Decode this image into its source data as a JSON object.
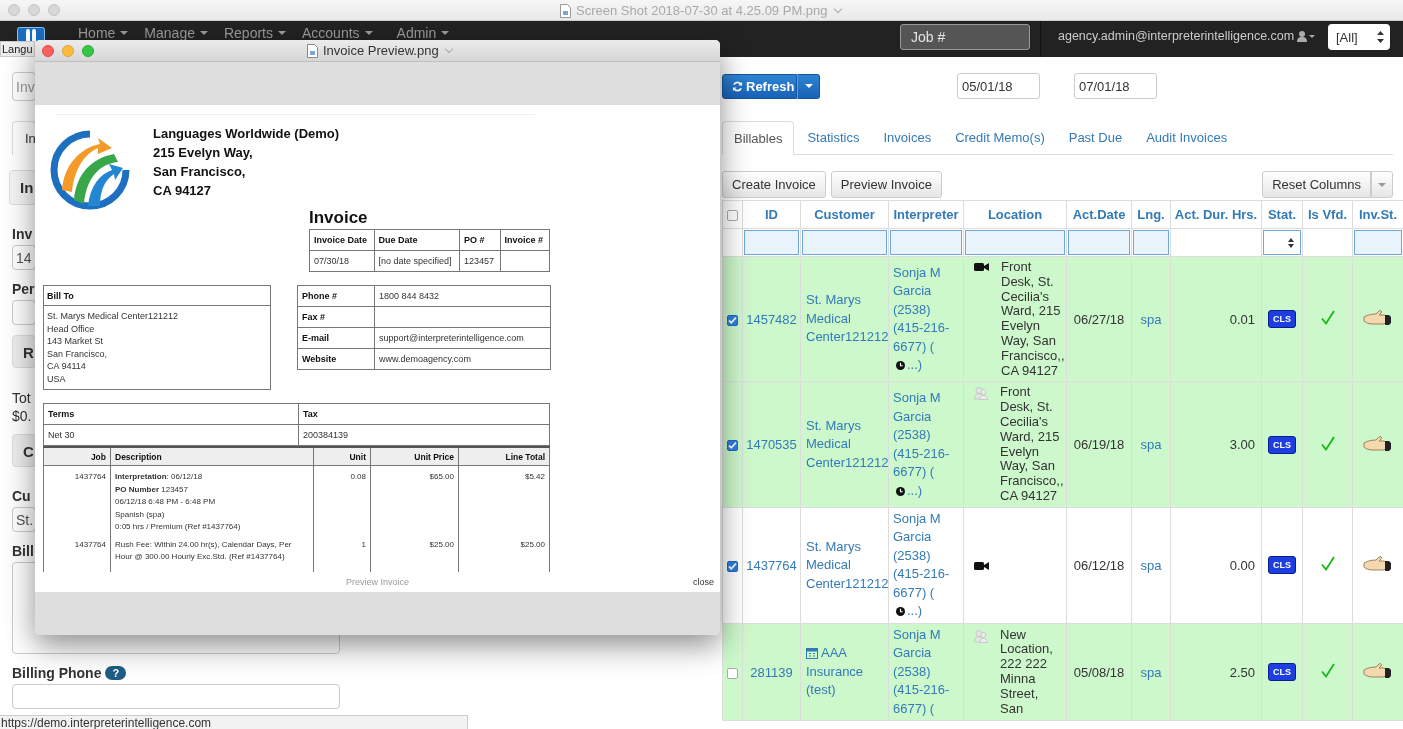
{
  "window": {
    "title": "Screen Shot 2018-07-30 at 4.25.09 PM.png"
  },
  "navbar": {
    "menu": [
      {
        "label": "Home"
      },
      {
        "label": "Manage"
      },
      {
        "label": "Reports"
      },
      {
        "label": "Accounts"
      },
      {
        "label": "Admin"
      }
    ],
    "job_search": {
      "placeholder": "Job #"
    },
    "user": "agency.admin@interpreterintelligence.com",
    "scope_select": {
      "value": "[All]"
    }
  },
  "logo_tooltip": "Langu",
  "left_panel": [
    {
      "kind": "field",
      "placeholder": "Inv"
    },
    {
      "kind": "tab",
      "text": "In"
    },
    {
      "kind": "panel",
      "text": "In"
    },
    {
      "kind": "label",
      "text": "Inv"
    },
    {
      "kind": "field",
      "value": "14"
    },
    {
      "kind": "label",
      "text": "Per"
    },
    {
      "kind": "field"
    },
    {
      "kind": "button",
      "text": "R"
    },
    {
      "kind": "plain",
      "text": "Tot"
    },
    {
      "kind": "value",
      "text": "$0."
    },
    {
      "kind": "button",
      "text": "C"
    },
    {
      "kind": "label",
      "text": "Cu"
    },
    {
      "kind": "field",
      "value": "St."
    },
    {
      "kind": "label",
      "text": "Bill"
    },
    {
      "kind": "textarea"
    },
    {
      "kind": "label",
      "text": "Billing Phone",
      "help": "?"
    },
    {
      "kind": "field"
    }
  ],
  "toolbar": {
    "refresh": "Refresh",
    "date_from": "05/01/18",
    "date_to": "07/01/18"
  },
  "tabs": [
    {
      "label": "Billables",
      "selected": true
    },
    {
      "label": "Statistics",
      "selected": false
    },
    {
      "label": "Invoices",
      "selected": false
    },
    {
      "label": "Credit Memo(s)",
      "selected": false
    },
    {
      "label": "Past Due",
      "selected": false
    },
    {
      "label": "Audit Invoices",
      "selected": false
    }
  ],
  "actions": [
    "Create Invoice",
    "Preview Invoice"
  ],
  "reset_columns": "Reset Columns",
  "table": {
    "header_checkbox": {
      "checked": false
    },
    "columns": [
      {
        "label": "ID",
        "kind": "input"
      },
      {
        "label": "Customer",
        "kind": "input"
      },
      {
        "label": "Interpreter",
        "kind": "input"
      },
      {
        "label": "Location",
        "kind": "input"
      },
      {
        "label": "Act.Date",
        "kind": "input"
      },
      {
        "label": "Lng.",
        "kind": "input"
      },
      {
        "label": "Act. Dur. Hrs.",
        "kind": "none"
      },
      {
        "label": "Stat.",
        "kind": "select"
      },
      {
        "label": "Is Vfd.",
        "kind": "none"
      },
      {
        "label": "Inv.St.",
        "kind": "input"
      }
    ],
    "rows": [
      {
        "selected": true,
        "color": "#ccf8cc",
        "id": "1457482",
        "customer": {
          "kind": "plain",
          "text": "St. Marys Medical Center121212"
        },
        "interpreter": "Sonja M Garcia (2538) (415-216-6677) (",
        "interpreter_tail": "...)",
        "location": {
          "kind": "video",
          "text": "Front Desk, St. Cecilia's Ward, 215 Evelyn Way, San Francisco,, CA 94127"
        },
        "date": "06/27/18",
        "language": "spa",
        "duration": "0.01",
        "status": "CLS",
        "verified": true
      },
      {
        "selected": true,
        "color": "#ccf8cc",
        "id": "1470535",
        "customer": {
          "kind": "plain",
          "text": "St. Marys Medical Center121212"
        },
        "interpreter": "Sonja M Garcia (2538) (415-216-6677) (",
        "interpreter_tail": "...)",
        "location": {
          "kind": "people",
          "text": "Front Desk, St. Cecilia's Ward, 215 Evelyn Way, San Francisco,, CA 94127"
        },
        "date": "06/19/18",
        "language": "spa",
        "duration": "3.00",
        "status": "CLS",
        "verified": true
      },
      {
        "selected": true,
        "color": "#ffffff",
        "id": "1437764",
        "customer": {
          "kind": "plain",
          "text": "St. Marys Medical Center121212"
        },
        "interpreter": "Sonja M Garcia (2538) (415-216-6677) (",
        "interpreter_tail": "...)",
        "location": {
          "kind": "video"
        },
        "date": "06/12/18",
        "language": "spa",
        "duration": "0.00",
        "status": "CLS",
        "verified": true
      },
      {
        "selected": false,
        "color": "#ccf8cc",
        "id": "281139",
        "customer": {
          "kind": "calendar",
          "text": "AAA Insurance (test)"
        },
        "interpreter": "Sonja M Garcia (2538) (415-216-6677) (",
        "location": {
          "kind": "people",
          "text": "New Location, 222 222 Minna Street, San"
        },
        "date": "05/08/18",
        "language": "spa",
        "duration": "2.50",
        "status": "CLS",
        "verified": true
      }
    ]
  },
  "preview_window": {
    "title": "Invoice Preview.png",
    "invoice": {
      "company": [
        "Languages Worldwide (Demo)",
        "215 Evelyn Way,",
        "San Francisco,",
        "CA 94127"
      ],
      "heading": "Invoice",
      "info": {
        "columns": [
          "Invoice Date",
          "Due Date",
          "PO #",
          "Invoice #"
        ],
        "values": [
          "07/30/18",
          "[no date specified]",
          "123457"
        ]
      },
      "bill_to": {
        "label": "Bill To",
        "lines": [
          "St. Marys Medical Center121212",
          "Head Office",
          "143 Market St",
          "San Francisco,",
          "CA 94114",
          "USA"
        ]
      },
      "contact": [
        {
          "label": "Phone #",
          "value": "1800 844 8432"
        },
        {
          "label": "Fax #"
        },
        {
          "label": "E-mail",
          "value": "support@interpreterintelligence.com"
        },
        {
          "label": "Website",
          "value": "www.demoagency.com"
        }
      ],
      "terms": {
        "label": "Terms",
        "value": "Net 30"
      },
      "tax": {
        "label": "Tax",
        "value": "200384139"
      },
      "items": {
        "columns": [
          "Job",
          "Description",
          "Unit",
          "Unit Price",
          "Line Total"
        ],
        "rows": [
          {
            "job": "1437764",
            "description": [
              "**Interpretation**: 06/12/18",
              "**PO Number** 123457",
              "06/12/18 6:48 PM - 6:48 PM",
              "Spanish (spa)",
              "0:05 hrs / Premium (Ref #1437764)"
            ],
            "unit": "0.08",
            "unit_price": "$65.00",
            "line_total": "$5.42"
          },
          {
            "job": "1437764",
            "description": [
              "Rush Fee: Within 24.00 hr(s), Calendar Days, Per Hour @ 300.00 Hourly Exc.Std. (Ref #1437764)"
            ],
            "unit": "1",
            "unit_price": "$25.00",
            "line_total": "$25.00"
          }
        ]
      }
    },
    "footer": {
      "title": "Preview Invoice",
      "close": "close"
    }
  },
  "status_bar": "https://demo.interpreterintelligence.com"
}
